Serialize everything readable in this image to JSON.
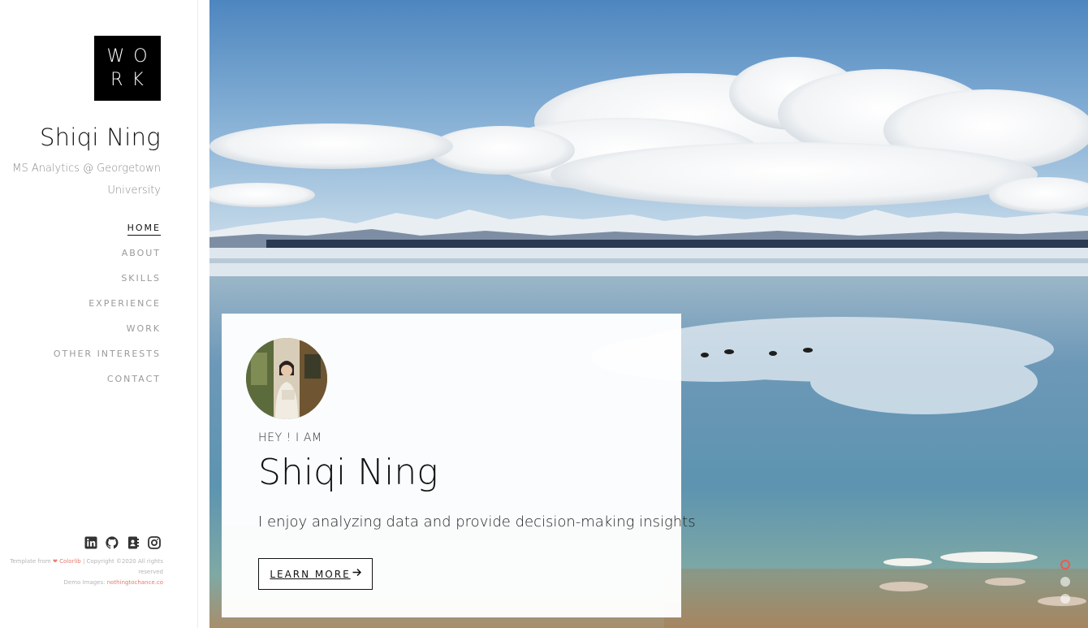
{
  "logo": {
    "line1": "WO",
    "line2": "RK"
  },
  "site": {
    "name": "Shiqi Ning",
    "tagline": "MS Analytics @ Georgetown University"
  },
  "nav": [
    {
      "label": "HOME",
      "active": true
    },
    {
      "label": "ABOUT",
      "active": false
    },
    {
      "label": "SKILLS",
      "active": false
    },
    {
      "label": "EXPERIENCE",
      "active": false
    },
    {
      "label": "WORK",
      "active": false
    },
    {
      "label": "OTHER INTERESTS",
      "active": false
    },
    {
      "label": "CONTACT",
      "active": false
    }
  ],
  "social": [
    "linkedin-icon",
    "github-icon",
    "contact-card-icon",
    "instagram-icon"
  ],
  "footer": {
    "template_prefix": "Template from",
    "heart": "❤",
    "colorlib": "Colorlib",
    "copyright": "| Copyright ©2020 All rights reserved",
    "demo_prefix": "Demo Images:",
    "demo_link": "nothingtochance.co"
  },
  "hero": {
    "greeting": "HEY ! I AM",
    "name": "Shiqi Ning",
    "description": "I enjoy analyzing data and provide decision-making insights",
    "button_label": "LEARN MORE",
    "button_icon": "arrow-right-icon"
  },
  "slider": {
    "count": 3,
    "active_index": 0,
    "accent": "#ef5a4e"
  }
}
